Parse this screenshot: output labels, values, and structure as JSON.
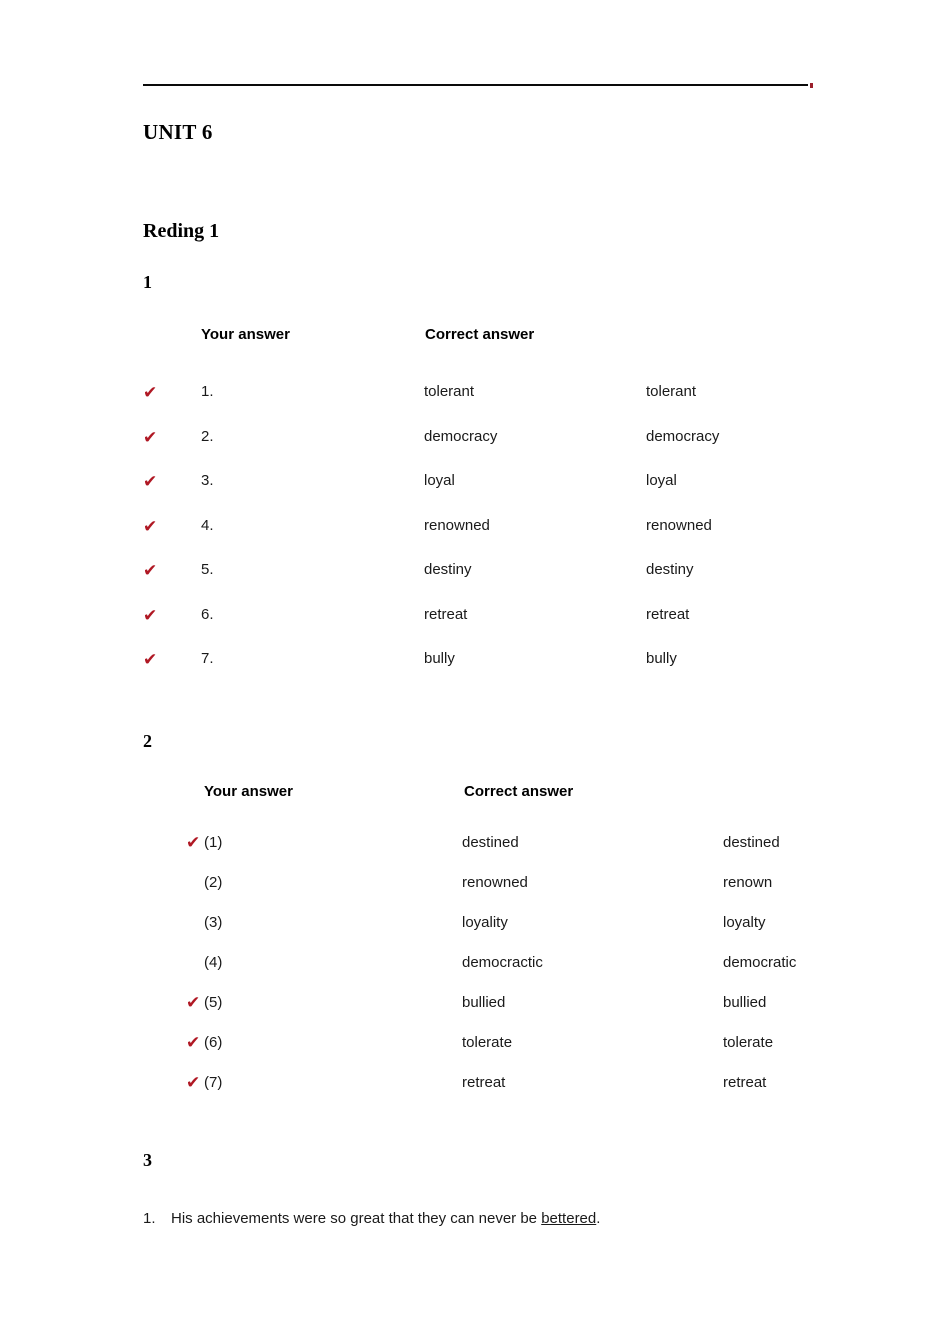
{
  "document": {
    "unit_title": "UNIT 6",
    "section_title": "Reding 1",
    "rule_accent_color": "#9b1f2b",
    "check_color": "#b01824",
    "check_glyph": "✔"
  },
  "exercise_1": {
    "number": "1",
    "headers": {
      "your_answer": "Your answer",
      "correct_answer": "Correct answer"
    },
    "rows": [
      {
        "index": "1.",
        "your": "tolerant",
        "correct": "tolerant",
        "correct_mark": true
      },
      {
        "index": "2.",
        "your": "democracy",
        "correct": "democracy",
        "correct_mark": true
      },
      {
        "index": "3.",
        "your": "loyal",
        "correct": "loyal",
        "correct_mark": true
      },
      {
        "index": "4.",
        "your": "renowned",
        "correct": "renowned",
        "correct_mark": true
      },
      {
        "index": "5.",
        "your": "destiny",
        "correct": "destiny",
        "correct_mark": true
      },
      {
        "index": "6.",
        "your": "retreat",
        "correct": "retreat",
        "correct_mark": true
      },
      {
        "index": "7.",
        "your": "bully",
        "correct": "bully",
        "correct_mark": true
      }
    ]
  },
  "exercise_2": {
    "number": "2",
    "headers": {
      "your_answer": "Your answer",
      "correct_answer": "Correct answer"
    },
    "rows": [
      {
        "index": "(1)",
        "your": "destined",
        "correct": "destined",
        "correct_mark": true
      },
      {
        "index": "(2)",
        "your": "renowned",
        "correct": "renown",
        "correct_mark": false
      },
      {
        "index": "(3)",
        "your": "loyality",
        "correct": "loyalty",
        "correct_mark": false
      },
      {
        "index": "(4)",
        "your": "democractic",
        "correct": "democratic",
        "correct_mark": false
      },
      {
        "index": "(5)",
        "your": "bullied",
        "correct": "bullied",
        "correct_mark": true
      },
      {
        "index": "(6)",
        "your": "tolerate",
        "correct": "tolerate",
        "correct_mark": true
      },
      {
        "index": "(7)",
        "your": "retreat",
        "correct": "retreat",
        "correct_mark": true
      }
    ]
  },
  "exercise_3": {
    "number": "3",
    "items": [
      {
        "marker": "1.",
        "before": "His achievements were so great that they can never be ",
        "answer": "bettered",
        "after": "."
      }
    ]
  }
}
